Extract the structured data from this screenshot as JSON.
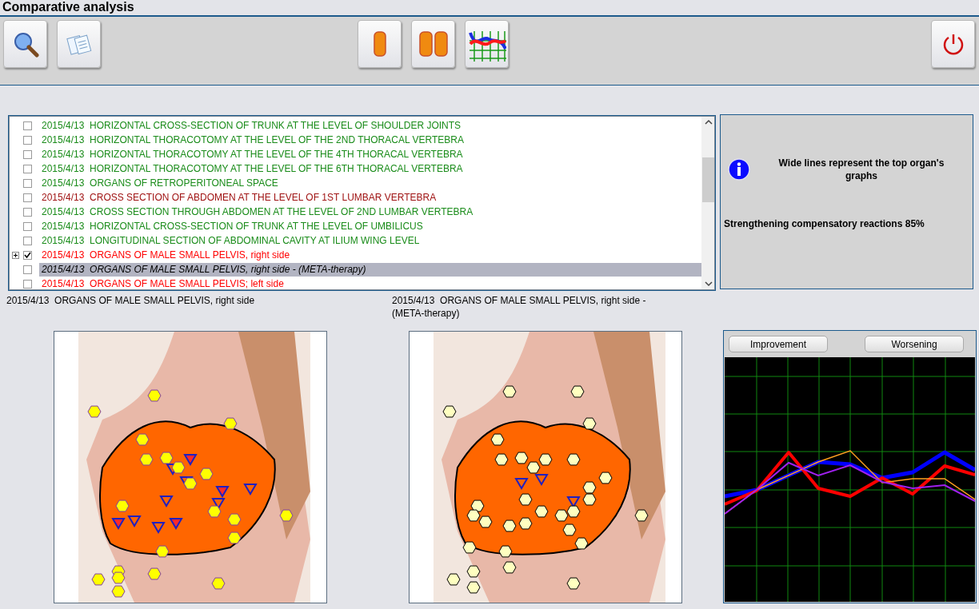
{
  "window": {
    "title": "Comparative analysis"
  },
  "records": [
    {
      "text": "2015/4/13  HORIZONTAL CROSS-SECTION OF TRUNK AT THE LEVEL OF SHOULDER JOINTS",
      "color": "#1a8c1a",
      "checked": false,
      "selected": false,
      "expandable": false
    },
    {
      "text": "2015/4/13  HORIZONTAL THORACOTOMY AT THE LEVEL OF THE 2ND THORACAL VERTEBRA",
      "color": "#1a8c1a",
      "checked": false,
      "selected": false,
      "expandable": false
    },
    {
      "text": "2015/4/13  HORIZONTAL THORACOTOMY AT THE LEVEL OF THE 4TH THORACAL VERTEBRA",
      "color": "#1a8c1a",
      "checked": false,
      "selected": false,
      "expandable": false
    },
    {
      "text": "2015/4/13  HORIZONTAL THORACOTOMY AT THE LEVEL OF THE 6TH THORACAL VERTEBRA",
      "color": "#1a8c1a",
      "checked": false,
      "selected": false,
      "expandable": false
    },
    {
      "text": "2015/4/13  ORGANS OF RETROPERITONEAL SPACE",
      "color": "#1a8c1a",
      "checked": false,
      "selected": false,
      "expandable": false
    },
    {
      "text": "2015/4/13  CROSS SECTION OF ABDOMEN AT THE LEVEL OF 1ST LUMBAR VERTEBRA",
      "color": "#a01414",
      "checked": false,
      "selected": false,
      "expandable": false
    },
    {
      "text": "2015/4/13  CROSS SECTION THROUGH ABDOMEN AT THE LEVEL OF 2ND LUMBAR VERTEBRA",
      "color": "#1a8c1a",
      "checked": false,
      "selected": false,
      "expandable": false
    },
    {
      "text": "2015/4/13  HORIZONTAL CROSS-SECTION OF TRUNK AT THE LEVEL OF UMBILICUS",
      "color": "#1a8c1a",
      "checked": false,
      "selected": false,
      "expandable": false
    },
    {
      "text": "2015/4/13  LONGITUDINAL SECTION OF ABDOMINAL CAVITY AT ILIUM WING LEVEL",
      "color": "#1a8c1a",
      "checked": false,
      "selected": false,
      "expandable": false
    },
    {
      "text": "2015/4/13  ORGANS OF MALE SMALL PELVIS, right side",
      "color": "#ff0000",
      "checked": true,
      "selected": false,
      "expandable": true
    },
    {
      "text": "2015/4/13  ORGANS OF MALE SMALL PELVIS, right side - (META-therapy)",
      "color": "#000000",
      "checked": false,
      "selected": true,
      "expandable": false
    },
    {
      "text": "2015/4/13  ORGANS OF MALE SMALL PELVIS; left side",
      "color": "#ff0000",
      "checked": false,
      "selected": false,
      "expandable": false
    }
  ],
  "info": {
    "message": "Wide lines represent the top organ's graphs",
    "summary": "Strengthening compensatory reactions 85%"
  },
  "comparison": [
    {
      "caption": "2015/4/13  ORGANS OF MALE SMALL PELVIS, right side"
    },
    {
      "caption": "2015/4/13  ORGANS OF MALE SMALL PELVIS, right side - (META-therapy)"
    }
  ],
  "graph": {
    "buttons": [
      "Improvement",
      "Worsening"
    ]
  }
}
